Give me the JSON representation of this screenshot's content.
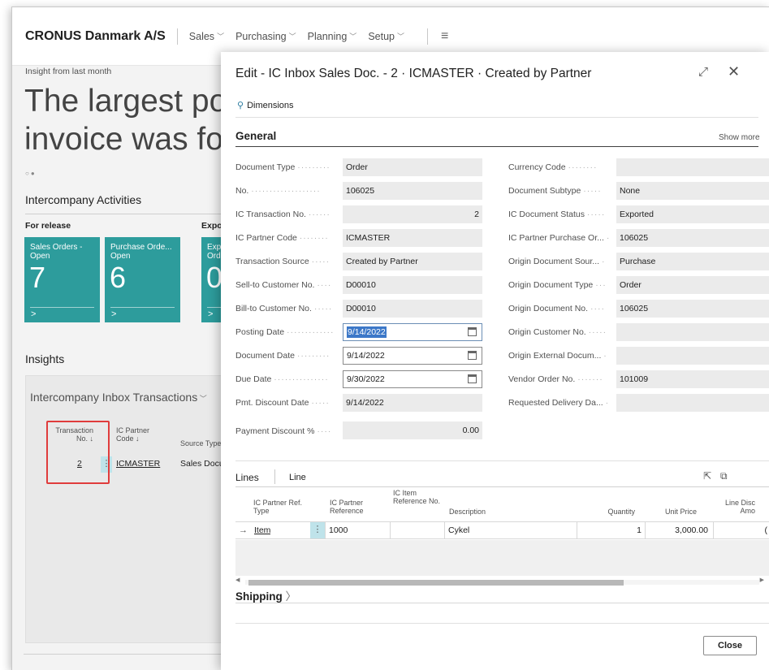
{
  "app": {
    "company": "CRONUS Danmark A/S",
    "nav": [
      "Sales",
      "Purchasing",
      "Planning",
      "Setup"
    ],
    "insight_small": "Insight from last month",
    "insight_line1": "The largest pos",
    "insight_line2": "invoice was for",
    "ic_activities": "Intercompany Activities",
    "for_release": "For release",
    "export_label": "Expo",
    "tiles": [
      {
        "title": "Sales Orders -\nOpen",
        "value": "7"
      },
      {
        "title": "Purchase Orde...\nOpen",
        "value": "6"
      },
      {
        "title": "Exp\nOrd",
        "value": "0"
      }
    ],
    "insights": "Insights",
    "panel_title": "Intercompany Inbox Transactions",
    "mini_table": {
      "h1": "Transaction No. ↓",
      "h2": "IC Partner Code ↓",
      "h3": "Source Type",
      "v1": "2",
      "v2": "ICMASTER",
      "v3": "Sales Docu"
    }
  },
  "dialog": {
    "title": "Edit - IC Inbox Sales Doc. - 2 · ICMASTER · Created by Partner",
    "dimensions": "Dimensions",
    "general": "General",
    "show_more": "Show more",
    "left_fields": [
      {
        "label": "Document Type",
        "value": "Order"
      },
      {
        "label": "No.",
        "value": "106025"
      },
      {
        "label": "IC Transaction No.",
        "value": "2"
      },
      {
        "label": "IC Partner Code",
        "value": "ICMASTER"
      },
      {
        "label": "Transaction Source",
        "value": "Created by Partner"
      },
      {
        "label": "Sell-to Customer No.",
        "value": "D00010"
      },
      {
        "label": "Bill-to Customer No.",
        "value": "D00010"
      },
      {
        "label": "Posting Date",
        "value": "9/14/2022"
      },
      {
        "label": "Document Date",
        "value": "9/14/2022"
      },
      {
        "label": "Due Date",
        "value": "9/30/2022"
      },
      {
        "label": "Pmt. Discount Date",
        "value": "9/14/2022"
      },
      {
        "label": "Payment Discount %",
        "value": "0.00"
      }
    ],
    "right_fields": [
      {
        "label": "Currency Code",
        "value": ""
      },
      {
        "label": "Document Subtype",
        "value": "None"
      },
      {
        "label": "IC Document Status",
        "value": "Exported"
      },
      {
        "label": "IC Partner Purchase Or...",
        "value": "106025"
      },
      {
        "label": "Origin Document Sour...",
        "value": "Purchase"
      },
      {
        "label": "Origin Document Type",
        "value": "Order"
      },
      {
        "label": "Origin Document No.",
        "value": "106025"
      },
      {
        "label": "Origin Customer No.",
        "value": ""
      },
      {
        "label": "Origin External Docum...",
        "value": ""
      },
      {
        "label": "Vendor Order No.",
        "value": "101009"
      },
      {
        "label": "Requested Delivery Da...",
        "value": ""
      }
    ],
    "lines": {
      "title": "Lines",
      "tab": "Line",
      "headers": {
        "ref_type": "IC Partner Ref. Type",
        "reference": "IC Partner Reference",
        "item_ref": "IC Item Reference No.",
        "description": "Description",
        "quantity": "Quantity",
        "unit_price": "Unit Price",
        "line_disc": "Line Disc Amo"
      },
      "row": {
        "ref_type": "Item",
        "reference": "1000",
        "item_ref": "",
        "description": "Cykel",
        "quantity": "1",
        "unit_price": "3,000.00",
        "line_disc": "("
      }
    },
    "shipping": "Shipping",
    "close": "Close"
  }
}
